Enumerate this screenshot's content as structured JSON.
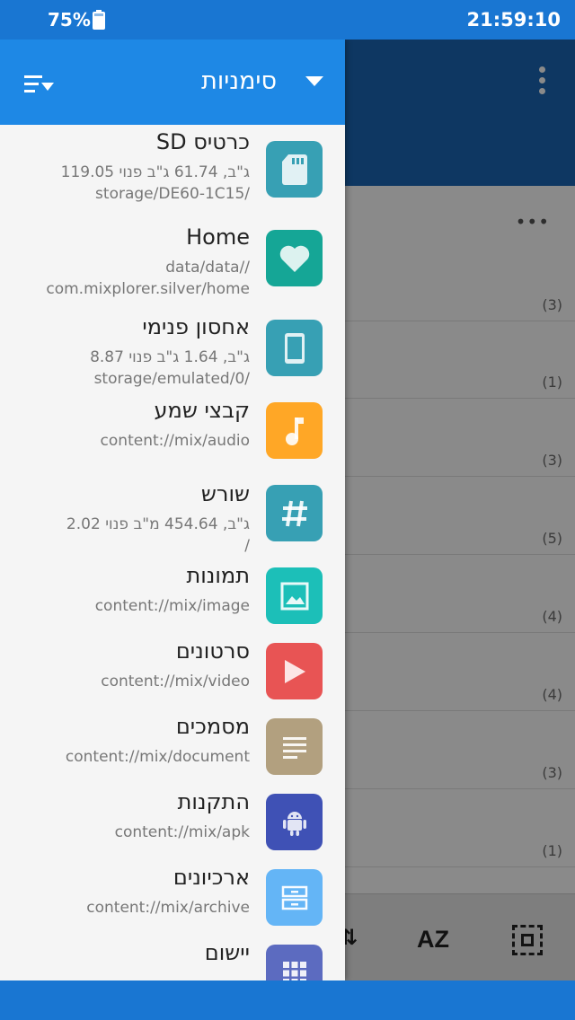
{
  "status_bar": {
    "battery": "75%",
    "time": "21:59:10"
  },
  "drawer": {
    "title": "סימניות",
    "items": [
      {
        "title": "כרטיס SD",
        "lines": [
          "119.05 ג\"ב,  61.74 ג\"ב פנוי",
          "storage/DE60-1C15/"
        ],
        "icon": "sd-card-icon",
        "color": "#37a0b4"
      },
      {
        "title": "Home",
        "lines": [
          "data/data//",
          "com.mixplorer.silver/home"
        ],
        "icon": "heart-icon",
        "color": "#15a696"
      },
      {
        "title": "אחסון פנימי",
        "lines": [
          "8.87 ג\"ב,  1.64 ג\"ב פנוי",
          "storage/emulated/0/"
        ],
        "icon": "phone-icon",
        "color": "#37a0b4"
      },
      {
        "title": "קבצי שמע",
        "lines": [
          "content://mix/audio"
        ],
        "icon": "music-note-icon",
        "color": "#ffa726"
      },
      {
        "title": "שורש",
        "lines": [
          "2.02 ג\"ב,  454.64 מ\"ב פנוי",
          "/"
        ],
        "icon": "hash-icon",
        "color": "#37a0b4"
      },
      {
        "title": "תמונות",
        "lines": [
          "content://mix/image"
        ],
        "icon": "image-icon",
        "color": "#1cbfb8"
      },
      {
        "title": "סרטונים",
        "lines": [
          "content://mix/video"
        ],
        "icon": "play-icon",
        "color": "#e85454"
      },
      {
        "title": "מסמכים",
        "lines": [
          "content://mix/document"
        ],
        "icon": "document-icon",
        "color": "#b2a07f"
      },
      {
        "title": "התקנות",
        "lines": [
          "content://mix/apk"
        ],
        "icon": "android-icon",
        "color": "#3f51b5"
      },
      {
        "title": "ארכיונים",
        "lines": [
          "content://mix/archive"
        ],
        "icon": "archive-icon",
        "color": "#64b5f6"
      },
      {
        "title": "יישום",
        "lines": [],
        "icon": "apps-grid-icon",
        "color": "#5c6bc0"
      }
    ]
  },
  "background": {
    "counts": [
      "(3)",
      "(1)",
      "(3)",
      "(5)",
      "(4)",
      "(4)",
      "(3)",
      "(1)"
    ],
    "sort_label": "AZ"
  }
}
